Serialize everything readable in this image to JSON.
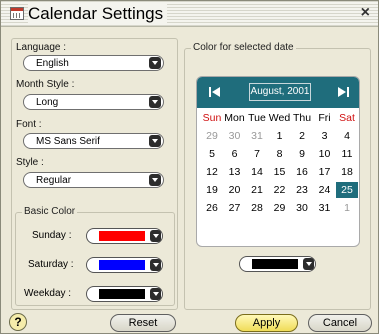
{
  "window": {
    "title": "Calendar Settings",
    "close_glyph": "×"
  },
  "settings": {
    "language_label": "Language :",
    "language_value": "English",
    "month_style_label": "Month Style :",
    "month_style_value": "Long",
    "font_label": "Font :",
    "font_value": "MS Sans Serif",
    "style_label": "Style :",
    "style_value": "Regular"
  },
  "basic_color": {
    "group_label": "Basic Color",
    "rows": [
      {
        "label": "Sunday :",
        "color": "#ff0000"
      },
      {
        "label": "Saturday :",
        "color": "#0000ff"
      },
      {
        "label": "Weekday :",
        "color": "#000000"
      }
    ]
  },
  "selected_date_color": {
    "group_label": "Color for selected date",
    "color": "#000000"
  },
  "calendar": {
    "month_label": "August, 2001",
    "header_color": "#1f6d7c",
    "weekdays": [
      "Sun",
      "Mon",
      "Tue",
      "Wed",
      "Thu",
      "Fri",
      "Sat"
    ],
    "weeks": [
      [
        "29",
        "30",
        "31",
        "1",
        "2",
        "3",
        "4"
      ],
      [
        "5",
        "6",
        "7",
        "8",
        "9",
        "10",
        "11"
      ],
      [
        "12",
        "13",
        "14",
        "15",
        "16",
        "17",
        "18"
      ],
      [
        "19",
        "20",
        "21",
        "22",
        "23",
        "24",
        "25"
      ],
      [
        "26",
        "27",
        "28",
        "29",
        "30",
        "31",
        "1"
      ]
    ],
    "selected_day": "25"
  },
  "footer": {
    "help_label": "?",
    "reset_label": "Reset",
    "apply_label": "Apply",
    "cancel_label": "Cancel"
  }
}
